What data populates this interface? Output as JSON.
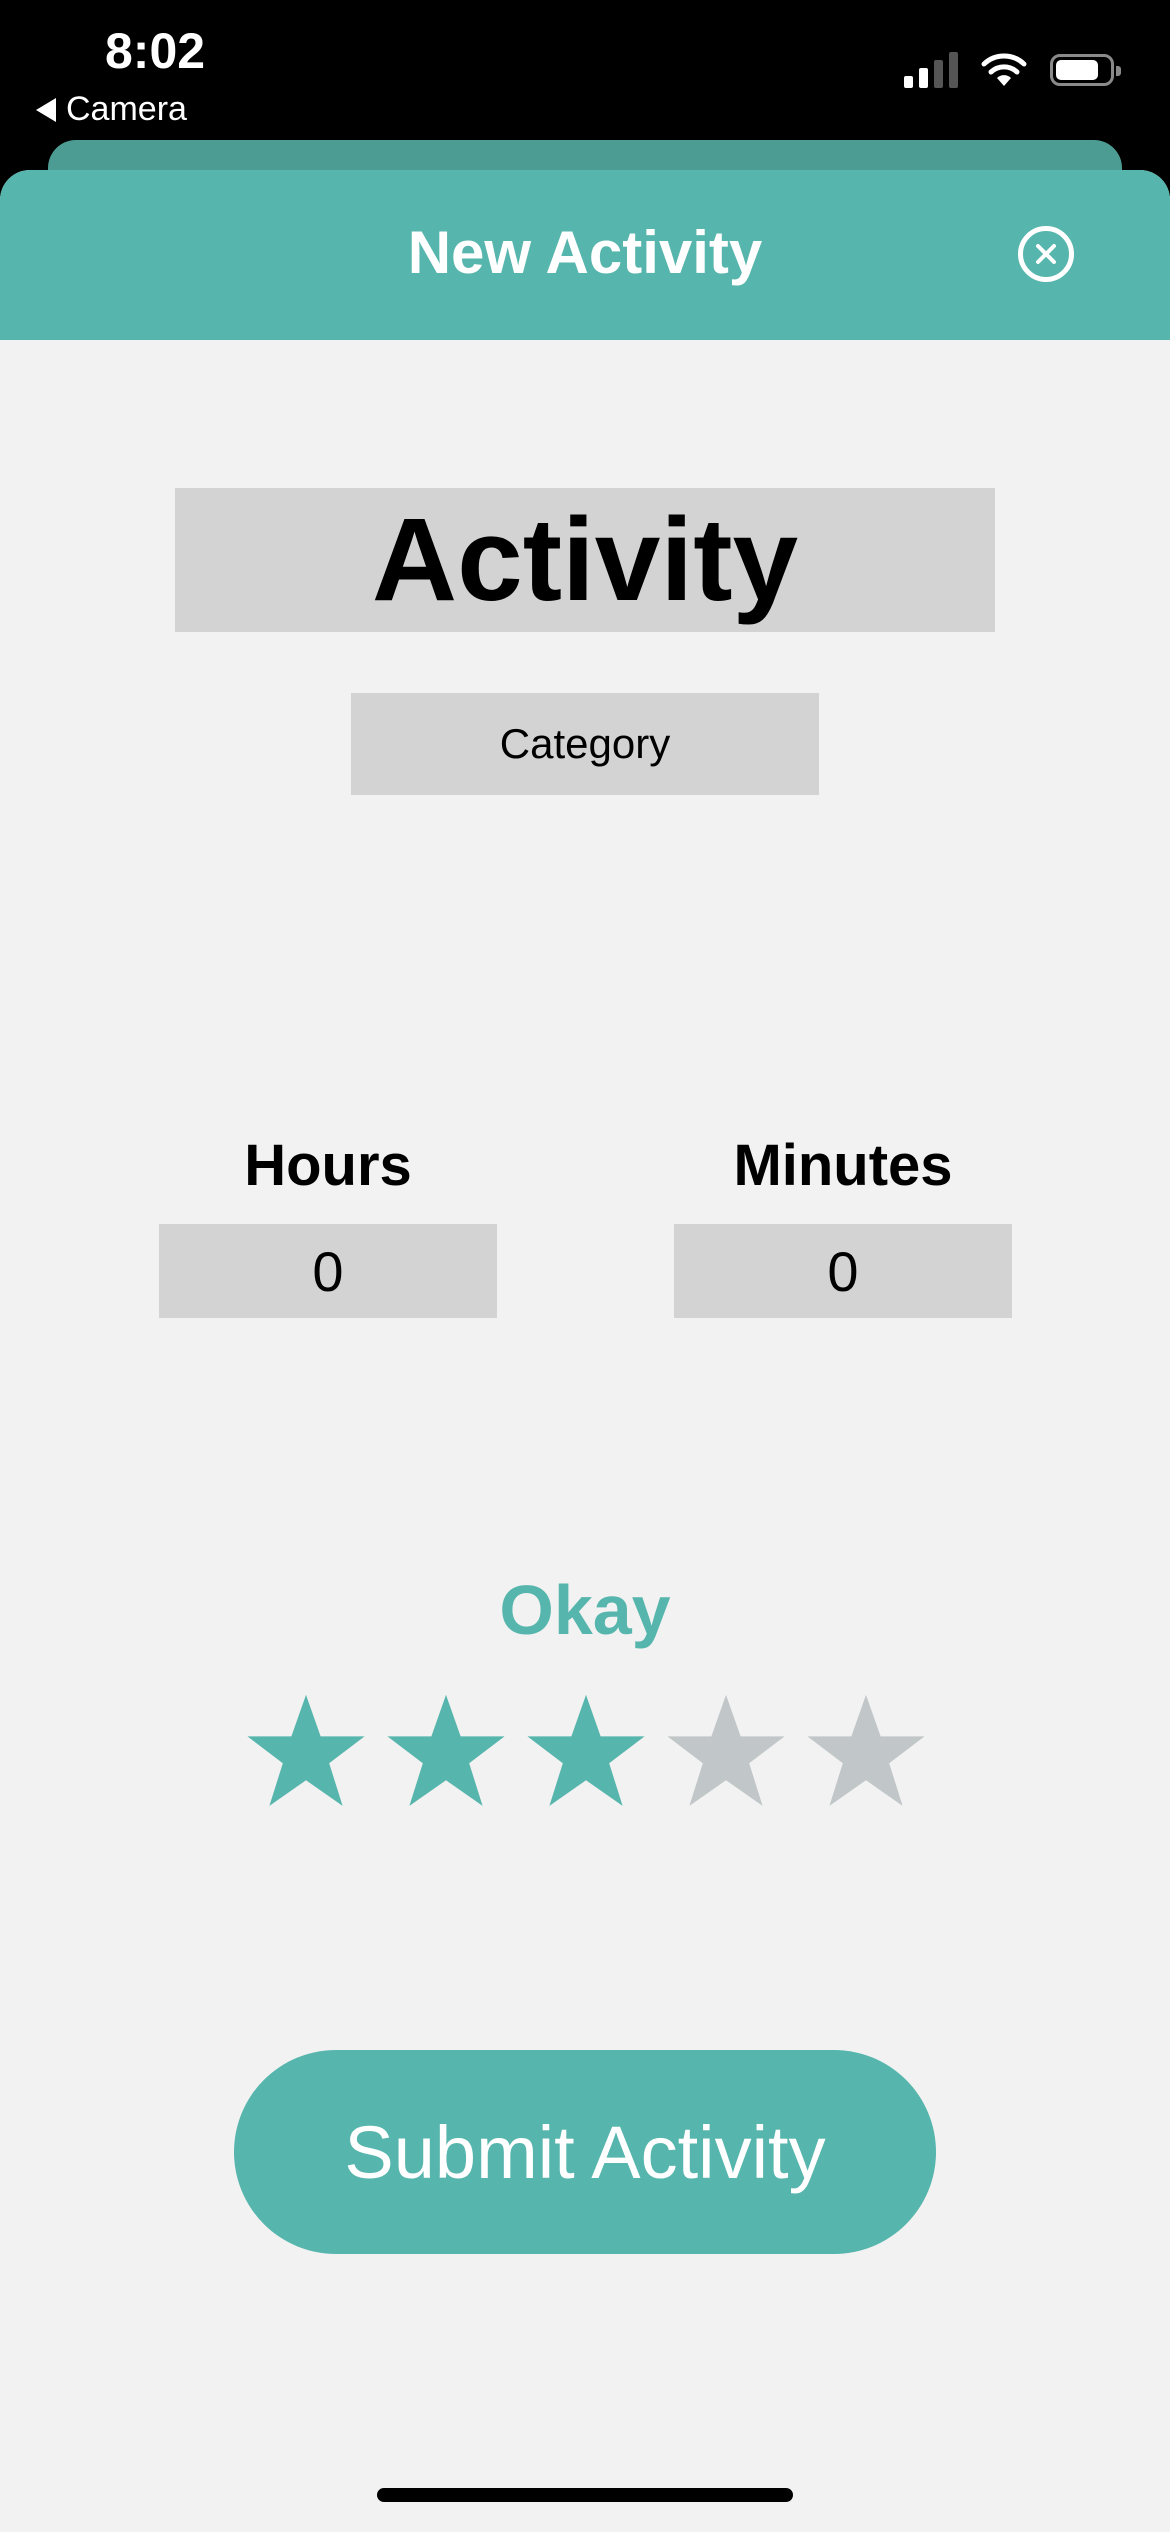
{
  "status_bar": {
    "time": "8:02",
    "back_app": "Camera",
    "icons": [
      "cellular-signal-icon",
      "wifi-icon",
      "battery-icon"
    ]
  },
  "header": {
    "title": "New Activity",
    "close_icon": "close-circle-icon"
  },
  "form": {
    "activity_value": "Activity",
    "category_value": "Category",
    "hours_label": "Hours",
    "hours_value": "0",
    "minutes_label": "Minutes",
    "minutes_value": "0"
  },
  "rating": {
    "label": "Okay",
    "value": 3,
    "max": 5
  },
  "submit_label": "Submit Activity",
  "colors": {
    "accent": "#56b5ac",
    "star_empty": "#c1c6c8",
    "field_bg": "#d3d3d3",
    "background": "#f2f2f2"
  }
}
